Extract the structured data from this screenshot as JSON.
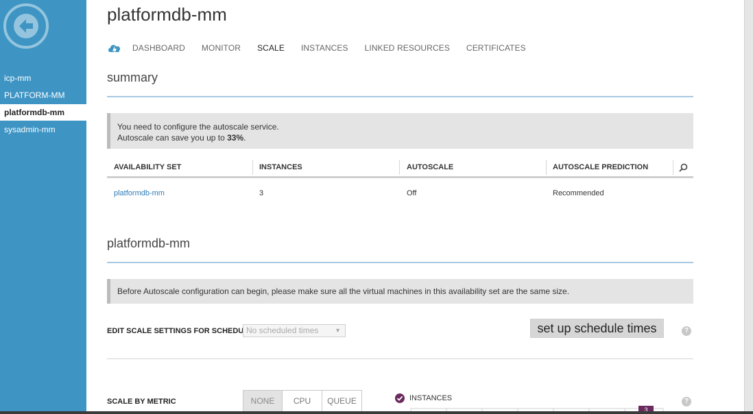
{
  "sidebar": {
    "items": [
      {
        "label": "icp-mm"
      },
      {
        "label": "PLATFORM-MM"
      },
      {
        "label": "platformdb-mm"
      },
      {
        "label": "sysadmin-mm"
      }
    ]
  },
  "header": {
    "title": "platformdb-mm",
    "tabs": [
      {
        "label": "DASHBOARD"
      },
      {
        "label": "MONITOR"
      },
      {
        "label": "SCALE"
      },
      {
        "label": "INSTANCES"
      },
      {
        "label": "LINKED RESOURCES"
      },
      {
        "label": "CERTIFICATES"
      }
    ],
    "active_tab": "SCALE"
  },
  "summary": {
    "heading": "summary",
    "notice": {
      "line1": "You need to configure the autoscale service.",
      "line2_prefix": "Autoscale can save you up to ",
      "line2_value": "33%",
      "line2_suffix": "."
    },
    "table": {
      "headers": [
        "AVAILABILITY SET",
        "INSTANCES",
        "AUTOSCALE",
        "AUTOSCALE PREDICTION"
      ],
      "rows": [
        {
          "availability_set": "platformdb-mm",
          "instances": "3",
          "autoscale": "Off",
          "prediction": "Recommended"
        }
      ]
    }
  },
  "availability_set": {
    "heading": "platformdb-mm",
    "notice": "Before Autoscale configuration can begin, please make sure all the virtual machines in this availability set are the same size.",
    "schedule_label": "EDIT SCALE SETTINGS FOR SCHEDULE",
    "schedule_select_value": "No scheduled times",
    "setup_button": "set up schedule times",
    "metric_label": "SCALE BY METRIC",
    "metric_options": [
      "NONE",
      "CPU",
      "QUEUE"
    ],
    "metric_selected": "NONE",
    "instances_check_label": "INSTANCES",
    "instances_check_checked": true,
    "chart_marker": "3"
  },
  "colors": {
    "sidebar": "#3e95c4",
    "accent_rule": "#a7c9e3",
    "link": "#2b7bb8",
    "check": "#6a2a5e"
  }
}
